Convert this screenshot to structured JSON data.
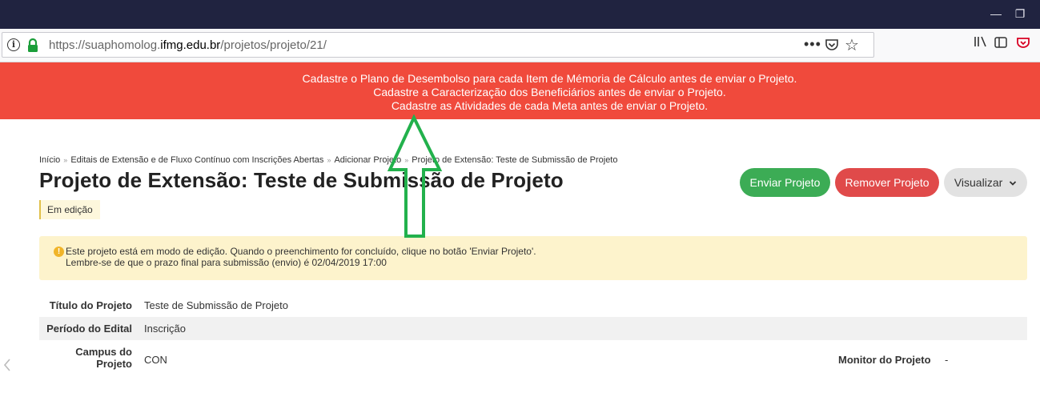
{
  "browser": {
    "url_prefix": "https://suaphomolog.",
    "url_host": "ifmg.edu.br",
    "url_path": "/projetos/projeto/21/",
    "page_actions": "•••",
    "star": "☆",
    "minimize": "—",
    "restore": "❐"
  },
  "alerts": [
    "Cadastre o Plano de Desembolso para cada Item de Mémoria de Cálculo antes de enviar o Projeto.",
    "Cadastre a Caracterização dos Beneficiários antes de enviar o Projeto.",
    "Cadastre as Atividades de cada Meta antes de enviar o Projeto."
  ],
  "breadcrumb": {
    "items": [
      "Início",
      "Editais de Extensão e de Fluxo Contínuo com Inscrições Abertas",
      "Adicionar Projeto",
      "Projeto de Extensão: Teste de Submissão de Projeto"
    ],
    "separator": "»"
  },
  "page": {
    "title": "Projeto de Extensão: Teste de Submissão de Projeto",
    "status": "Em edição"
  },
  "actions": {
    "send": "Enviar Projeto",
    "remove": "Remover Projeto",
    "view": "Visualizar",
    "view_caret": "⌄"
  },
  "notice": {
    "line1": "Este projeto está em modo de edição. Quando o preenchimento for concluído, clique no botão 'Enviar Projeto'.",
    "line2": "Lembre-se de que o prazo final para submissão (envio) é 02/04/2019 17:00"
  },
  "details": {
    "title_label": "Título do Projeto",
    "title_value": "Teste de Submissão de Projeto",
    "period_label": "Período do Edital",
    "period_value": "Inscrição",
    "campus_label_1": "Campus do",
    "campus_label_2": "Projeto",
    "campus_value": "CON",
    "monitor_label": "Monitor do Projeto",
    "monitor_value": "-"
  },
  "colors": {
    "alert_bg": "#f04a3c",
    "send_btn": "#3cac55",
    "remove_btn": "#e04a4a",
    "annotation_arrow": "#22b14c"
  }
}
